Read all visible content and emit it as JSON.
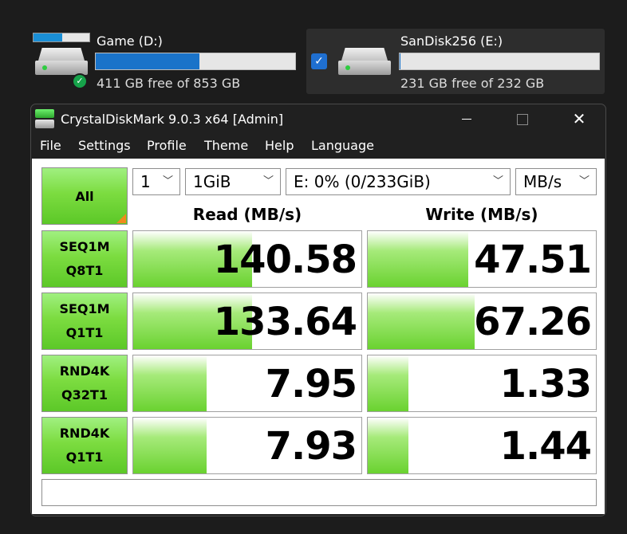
{
  "drives": [
    {
      "name": "Game (D:)",
      "free": "411 GB free of 853 GB",
      "used_fraction": 0.518,
      "selected": false
    },
    {
      "name": "SanDisk256 (E:)",
      "free": "231 GB free of 232 GB",
      "used_fraction": 0.004,
      "selected": true
    }
  ],
  "window": {
    "title": "CrystalDiskMark 9.0.3 x64 [Admin]",
    "menu": [
      "File",
      "Settings",
      "Profile",
      "Theme",
      "Help",
      "Language"
    ]
  },
  "controls": {
    "all_label": "All",
    "count": "1",
    "size": "1GiB",
    "drive": "E: 0% (0/233GiB)",
    "unit": "MB/s"
  },
  "columns": {
    "read": "Read (MB/s)",
    "write": "Write (MB/s)"
  },
  "tests": [
    {
      "l1": "SEQ1M",
      "l2": "Q8T1",
      "read": "140.58",
      "write": "47.51",
      "read_fill": 0.52,
      "write_fill": 0.44
    },
    {
      "l1": "SEQ1M",
      "l2": "Q1T1",
      "read": "133.64",
      "write": "67.26",
      "read_fill": 0.52,
      "write_fill": 0.47
    },
    {
      "l1": "RND4K",
      "l2": "Q32T1",
      "read": "7.95",
      "write": "1.33",
      "read_fill": 0.32,
      "write_fill": 0.18
    },
    {
      "l1": "RND4K",
      "l2": "Q1T1",
      "read": "7.93",
      "write": "1.44",
      "read_fill": 0.32,
      "write_fill": 0.18
    }
  ],
  "comment": "",
  "colors": {
    "accent": "#1a73c9",
    "bar_green": "#6ad230",
    "all_orange": "#f08a1c"
  }
}
